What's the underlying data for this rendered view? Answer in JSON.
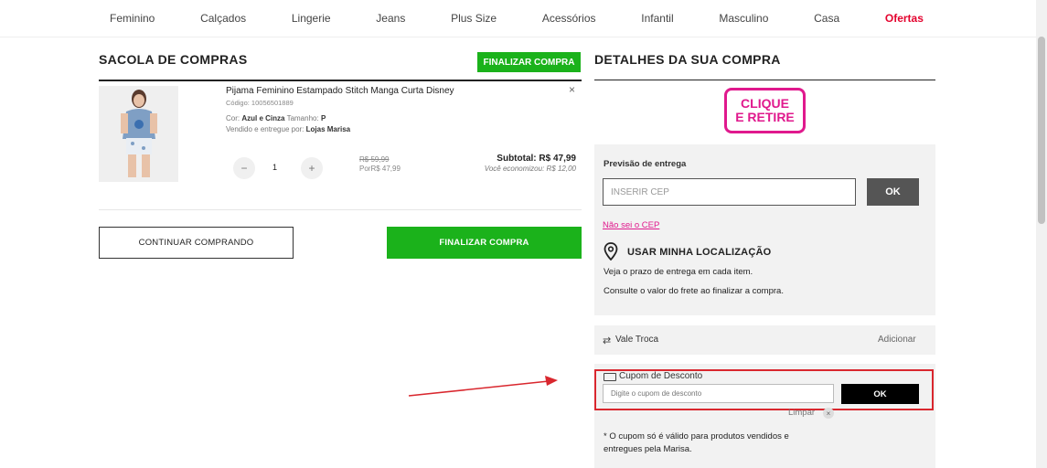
{
  "nav": {
    "items": [
      "Feminino",
      "Calçados",
      "Lingerie",
      "Jeans",
      "Plus Size",
      "Acessórios",
      "Infantil",
      "Masculino",
      "Casa",
      "Ofertas"
    ],
    "highlight_color": "#e4032e"
  },
  "bag": {
    "title": "SACOLA DE COMPRAS",
    "finalize_top_label": "FINALIZAR COMPRA",
    "product": {
      "name": "Pijama Feminino Estampado Stitch Manga Curta Disney",
      "code": "Código: 10056501889",
      "color_label": "Cor:",
      "color_value": "Azul e Cinza",
      "size_label": "Tamanho:",
      "size_value": "P",
      "seller_label": "Vendido e entregue por:",
      "seller_value": "Lojas Marisa",
      "remove_icon": "×",
      "quantity": "1",
      "qty_minus": "−",
      "qty_plus": "+",
      "price_old": "R$ 59,99",
      "price_por": "PorR$ 47,99",
      "subtotal": "Subtotal: R$ 47,99",
      "economy": "Você economizou: R$ 12,00"
    },
    "continue_label": "CONTINUAR COMPRANDO",
    "finalize_label": "FINALIZAR COMPRA",
    "accent_color": "#1bb21b"
  },
  "details": {
    "title": "DETALHES DA SUA COMPRA",
    "logo_line1": "CLIQUE",
    "logo_line2": "E RETIRE",
    "logo_color": "#e0198d",
    "delivery": {
      "label": "Previsão de entrega",
      "cep_placeholder": "INSERIR CEP",
      "ok_label": "OK",
      "nao_sei": "Não sei o CEP",
      "location_label": "USAR MINHA LOCALIZAÇÃO",
      "desc1": "Veja o prazo de entrega em cada item.",
      "desc2": "Consulte o valor do frete ao finalizar a compra."
    },
    "vale": {
      "icon": "⇄",
      "label": "Vale Troca",
      "add_label": "Adicionar"
    },
    "cupom": {
      "label": "Cupom de Desconto",
      "placeholder": "Digite o cupom de desconto",
      "ok_label": "OK",
      "limpar": "Limpar",
      "limpar_x": "×",
      "note1": "* O cupom só é válido para produtos vendidos e",
      "note2": "entregues pela Marisa."
    }
  }
}
